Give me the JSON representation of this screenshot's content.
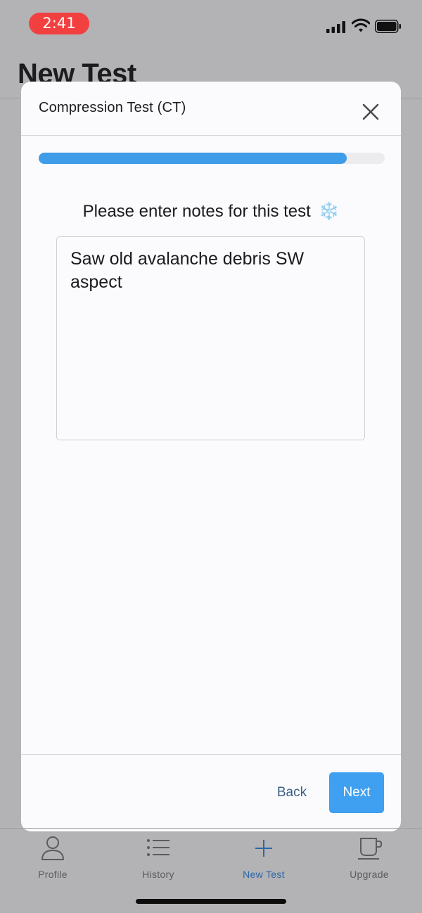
{
  "status_bar": {
    "time": "2:41",
    "icons": [
      "signal-icon",
      "wifi-icon",
      "battery-icon"
    ]
  },
  "background_page": {
    "title": "New Test"
  },
  "modal": {
    "title": "Compression Test (CT)",
    "close_icon": "close-icon",
    "progress_percent": 89,
    "prompt": "Please enter notes for this test",
    "prompt_emoji": "❄️",
    "notes_value": "Saw old avalanche debris SW aspect",
    "back_label": "Back",
    "next_label": "Next"
  },
  "tab_bar": {
    "tabs": [
      {
        "label": "Profile",
        "icon": "person-icon",
        "active": false
      },
      {
        "label": "History",
        "icon": "list-icon",
        "active": false
      },
      {
        "label": "New Test",
        "icon": "plus-icon",
        "active": true
      },
      {
        "label": "Upgrade",
        "icon": "coffee-cup-icon",
        "active": false
      }
    ]
  },
  "colors": {
    "accent": "#3f9ff0",
    "progress": "#3f9ce8",
    "active_tab": "#2b67a6",
    "time_pill": "#f24040",
    "overlay_background": "#b3b2b5"
  }
}
